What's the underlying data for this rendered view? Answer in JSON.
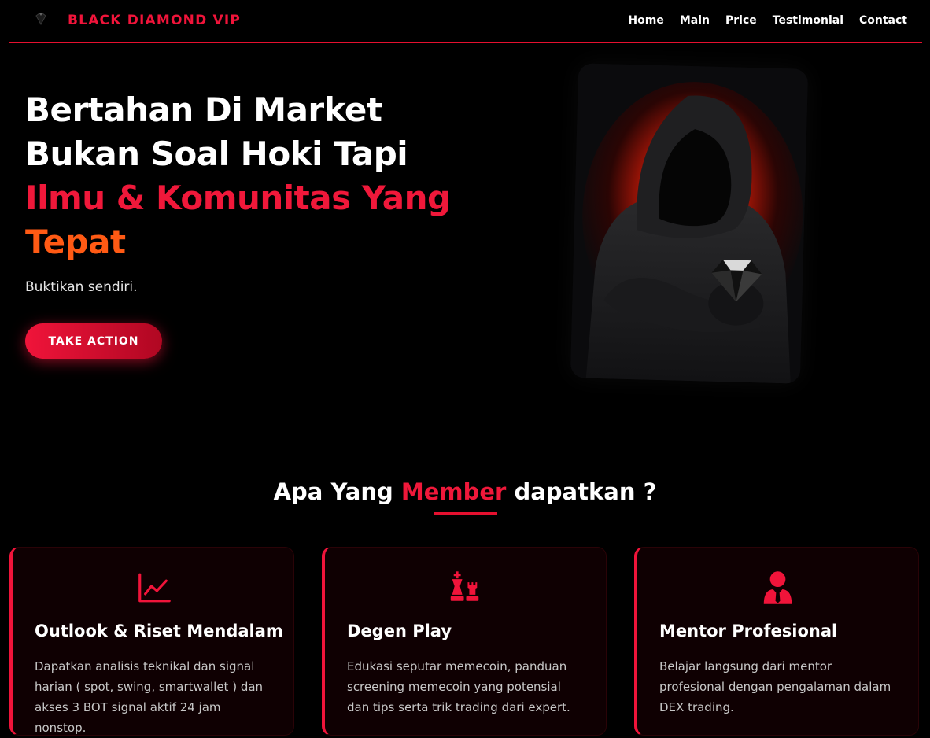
{
  "brand": {
    "name": "BLACK DIAMOND VIP",
    "logo_icon": "diamond-icon"
  },
  "nav": {
    "items": [
      {
        "label": "Home"
      },
      {
        "label": "Main"
      },
      {
        "label": "Price"
      },
      {
        "label": "Testimonial"
      },
      {
        "label": "Contact"
      }
    ]
  },
  "hero": {
    "title_line1": "Bertahan Di Market",
    "title_line2": "Bukan Soal Hoki Tapi",
    "title_line3": "Ilmu & Komunitas Yang",
    "title_line4": "Tepat",
    "subtitle": "Buktikan sendiri.",
    "cta_label": "TAKE ACTION",
    "image_subject": "hooded-figure-holding-diamond"
  },
  "features": {
    "title_pre": "Apa Yang",
    "title_highlight": "Member",
    "title_post": "dapatkan ?",
    "cards": [
      {
        "icon": "chart-line-icon",
        "title": "Outlook & Riset Mendalam",
        "desc": "Dapatkan analisis teknikal dan signal harian ( spot, swing, smartwallet ) dan akses 3 BOT signal aktif 24 jam nonstop."
      },
      {
        "icon": "chess-icon",
        "title": "Degen Play",
        "desc": "Edukasi seputar memecoin, panduan screening memecoin yang potensial dan tips serta trik trading dari expert."
      },
      {
        "icon": "user-tie-icon",
        "title": "Mentor Profesional",
        "desc": "Belajar langsung dari mentor profesional dengan pengalaman dalam DEX trading."
      }
    ]
  },
  "colors": {
    "accent_red": "#f0143a",
    "accent_orange": "#ff5a14",
    "background": "#000000",
    "card_bg": "#0f0002"
  }
}
